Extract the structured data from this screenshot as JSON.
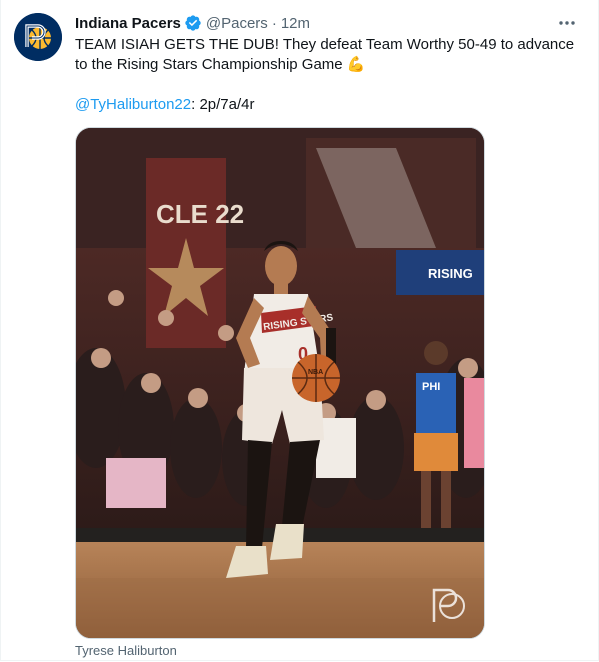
{
  "author": {
    "display_name": "Indiana Pacers",
    "handle": "@Pacers",
    "separator": "·",
    "time": "12m",
    "avatar_icon": "pacers-logo-icon",
    "verified_icon": "verified-badge-icon"
  },
  "tweet": {
    "line1": "TEAM ISIAH GETS THE DUB! They defeat Team Worthy 50-49 to advance to the Rising Stars Championship Game",
    "emoji": "💪",
    "mention": "@TyHaliburton22",
    "stat_line": ": 2p/7a/4r"
  },
  "media": {
    "jersey_text": "RISING STARS",
    "jersey_number": "0",
    "arena_banner": "CLE 22",
    "sign_text": "RISING",
    "shirt_text": "PHI",
    "ball_text": "NBA"
  },
  "caption": "Tyrese Haliburton",
  "colors": {
    "accent": "#1d9bf0",
    "text": "#0f1419",
    "secondary": "#536471",
    "pacers_navy": "#002d62",
    "pacers_gold": "#fdbb30"
  }
}
